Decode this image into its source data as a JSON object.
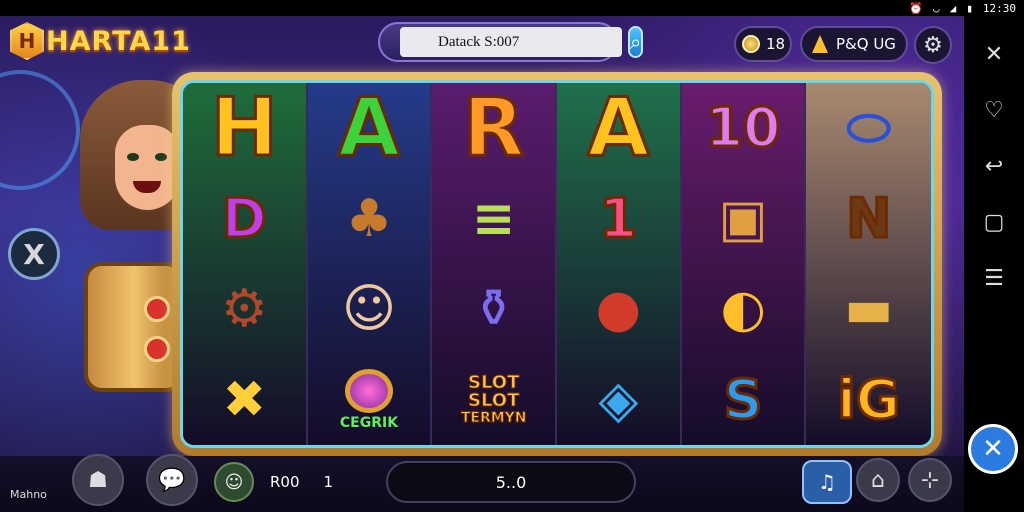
{
  "status": {
    "time": "12:30",
    "icons": [
      "alarm-icon",
      "wifi-icon",
      "signal-icon",
      "battery-icon"
    ]
  },
  "logo": {
    "badge": "H",
    "text": "HARTA11"
  },
  "search": {
    "value": "Datack S:007"
  },
  "coins": {
    "value": "18"
  },
  "balance": {
    "value": "P&Q UG"
  },
  "reels": [
    {
      "bg": "#1f6d3a",
      "symbols": [
        {
          "kind": "letter",
          "text": "H",
          "color": "#ffc21e"
        },
        {
          "kind": "letter",
          "text": "D",
          "color": "#c040e8",
          "small": true
        },
        {
          "kind": "icon",
          "name": "cannon-icon"
        },
        {
          "kind": "icon",
          "name": "bone-icon"
        }
      ]
    },
    {
      "bg": "#253b8a",
      "symbols": [
        {
          "kind": "letter",
          "text": "A",
          "color": "#3dd13a"
        },
        {
          "kind": "icon",
          "name": "plant-pot-icon"
        },
        {
          "kind": "icon",
          "name": "goblin-face-icon"
        },
        {
          "kind": "label",
          "text": "CEGRIK",
          "color": "#5ff05a",
          "name": "ring-potion-icon"
        }
      ]
    },
    {
      "bg": "#5b1c6e",
      "symbols": [
        {
          "kind": "letter",
          "text": "R",
          "color": "#ff9a26"
        },
        {
          "kind": "icon",
          "name": "scroll-icon"
        },
        {
          "kind": "icon",
          "name": "potion-jar-icon"
        },
        {
          "kind": "stack",
          "lines": [
            "SLOT",
            "SLOT",
            "TERMYN"
          ],
          "color": "#ffc64a"
        }
      ]
    },
    {
      "bg": "#20704a",
      "symbols": [
        {
          "kind": "letter",
          "text": "A",
          "color": "#ffc21e"
        },
        {
          "kind": "letter",
          "text": "1",
          "color": "#ff4d8a",
          "small": true
        },
        {
          "kind": "icon",
          "name": "bomb-icon"
        },
        {
          "kind": "icon",
          "name": "gem-frame-icon"
        }
      ]
    },
    {
      "bg": "#6a1c6d",
      "symbols": [
        {
          "kind": "letter",
          "text": "10",
          "color": "#e07af0",
          "small": true
        },
        {
          "kind": "icon",
          "name": "backpack-icon"
        },
        {
          "kind": "icon",
          "name": "golden-fish-icon"
        },
        {
          "kind": "letter",
          "text": "S",
          "color": "#2d9bf0",
          "small": true
        }
      ]
    },
    {
      "bg": "#a88a70",
      "symbols": [
        {
          "kind": "icon",
          "name": "blue-capsule-icon"
        },
        {
          "kind": "letter",
          "text": "N",
          "color": "#6b3a14",
          "small": true
        },
        {
          "kind": "icon",
          "name": "treasure-tray-icon"
        },
        {
          "kind": "letter",
          "text": "iG",
          "color": "#ffb51e",
          "small": true
        }
      ]
    }
  ],
  "bottom": {
    "label_left": "Mahno",
    "bet_label": "R00",
    "bet_count": "1",
    "win_value": "5..0"
  }
}
